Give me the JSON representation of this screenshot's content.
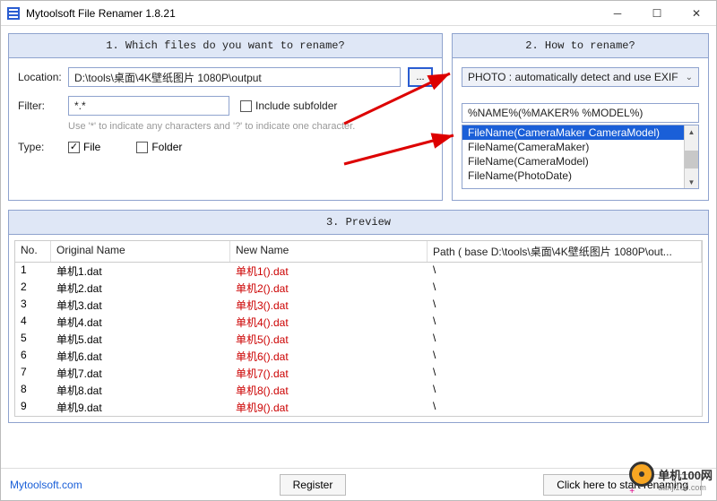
{
  "window": {
    "title": "Mytoolsoft File Renamer 1.8.21"
  },
  "panel1": {
    "header": "1. Which files do you want to rename?",
    "location_label": "Location:",
    "location_value": "D:\\tools\\桌面\\4K壁纸图片 1080P\\output",
    "browse": "...",
    "filter_label": "Filter:",
    "filter_value": "*.*",
    "include_subfolder": "Include subfolder",
    "help": "Use '*' to indicate any characters and '?' to indicate one character.",
    "type_label": "Type:",
    "file_label": "File",
    "folder_label": "Folder"
  },
  "panel2": {
    "header": "2. How to rename?",
    "mode": "PHOTO : automatically detect and use EXIF",
    "template": "%NAME%(%MAKER% %MODEL%)",
    "options": [
      "FileName(CameraMaker CameraModel)",
      "FileName(CameraMaker)",
      "FileName(CameraModel)",
      "FileName(PhotoDate)"
    ]
  },
  "preview": {
    "header": "3. Preview",
    "columns": {
      "no": "No.",
      "orig": "Original Name",
      "new": "New Name",
      "path": "Path ( base D:\\tools\\桌面\\4K壁纸图片 1080P\\out..."
    },
    "rows": [
      {
        "no": "1",
        "orig": "单机1.dat",
        "new": "单机1().dat",
        "path": "\\"
      },
      {
        "no": "2",
        "orig": "单机2.dat",
        "new": "单机2().dat",
        "path": "\\"
      },
      {
        "no": "3",
        "orig": "单机3.dat",
        "new": "单机3().dat",
        "path": "\\"
      },
      {
        "no": "4",
        "orig": "单机4.dat",
        "new": "单机4().dat",
        "path": "\\"
      },
      {
        "no": "5",
        "orig": "单机5.dat",
        "new": "单机5().dat",
        "path": "\\"
      },
      {
        "no": "6",
        "orig": "单机6.dat",
        "new": "单机6().dat",
        "path": "\\"
      },
      {
        "no": "7",
        "orig": "单机7.dat",
        "new": "单机7().dat",
        "path": "\\"
      },
      {
        "no": "8",
        "orig": "单机8.dat",
        "new": "单机8().dat",
        "path": "\\"
      },
      {
        "no": "9",
        "orig": "单机9.dat",
        "new": "单机9().dat",
        "path": "\\"
      }
    ]
  },
  "footer": {
    "link": "Mytoolsoft.com",
    "register": "Register",
    "start": "Click here to start renaming"
  },
  "watermark": {
    "line1": "单机100网",
    "line2": "danji100.com"
  }
}
